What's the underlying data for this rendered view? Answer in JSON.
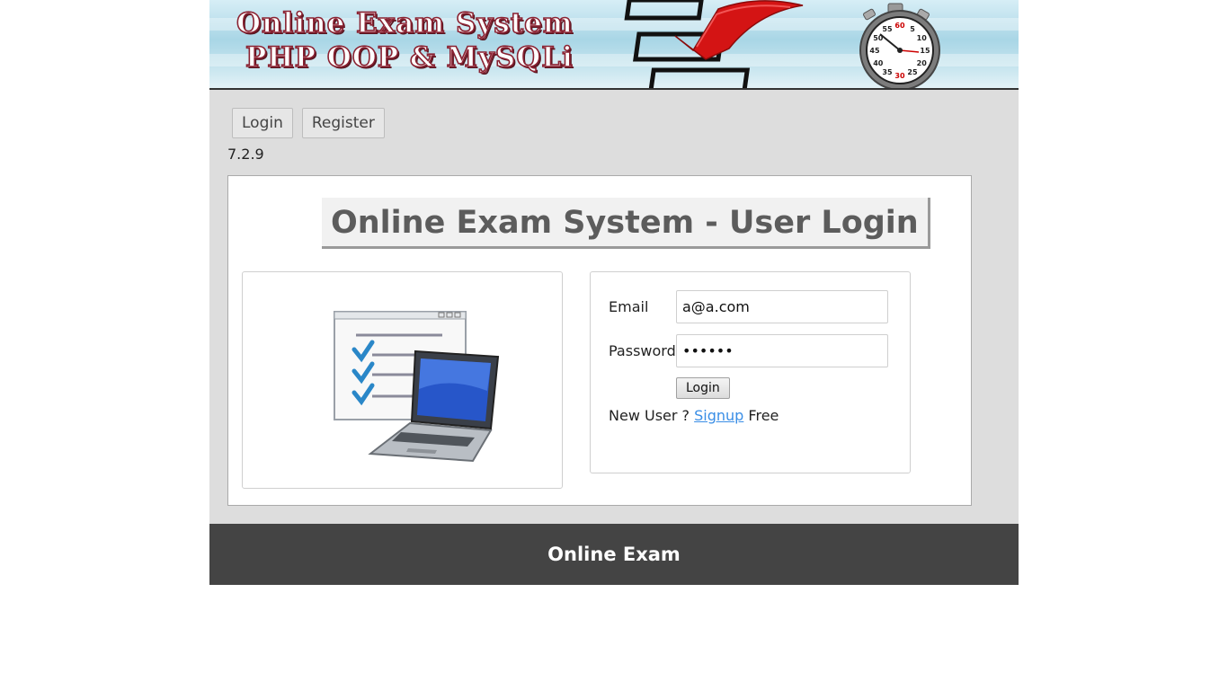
{
  "banner": {
    "title_line1": "Online Exam System",
    "title_line2": "PHP OOP & MySQLi",
    "stopwatch_numbers": [
      "60",
      "5",
      "10",
      "15",
      "20",
      "25",
      "30",
      "35",
      "40",
      "45",
      "50",
      "55"
    ]
  },
  "nav": {
    "items": [
      {
        "label": "Login"
      },
      {
        "label": "Register"
      }
    ]
  },
  "version": "7.2.9",
  "login_title": "Online Exam System - User Login",
  "form": {
    "email_label": "Email",
    "email_value": "a@a.com",
    "password_label": "Password",
    "password_value": "••••••",
    "submit_label": "Login",
    "signup_prefix": "New User ?",
    "signup_link": "Signup",
    "signup_suffix": "Free"
  },
  "footer": {
    "text": "Online Exam"
  },
  "colors": {
    "page_bg": "#dddddd",
    "footer_bg": "#444444",
    "link": "#3a8ee6",
    "title_text": "#5c5c5c",
    "check_red": "#d41414"
  },
  "icons": {
    "banner_checkmark": "red-checkmark-icon",
    "banner_clock": "stopwatch-icon",
    "illustration": "checklist-laptop-icon"
  }
}
